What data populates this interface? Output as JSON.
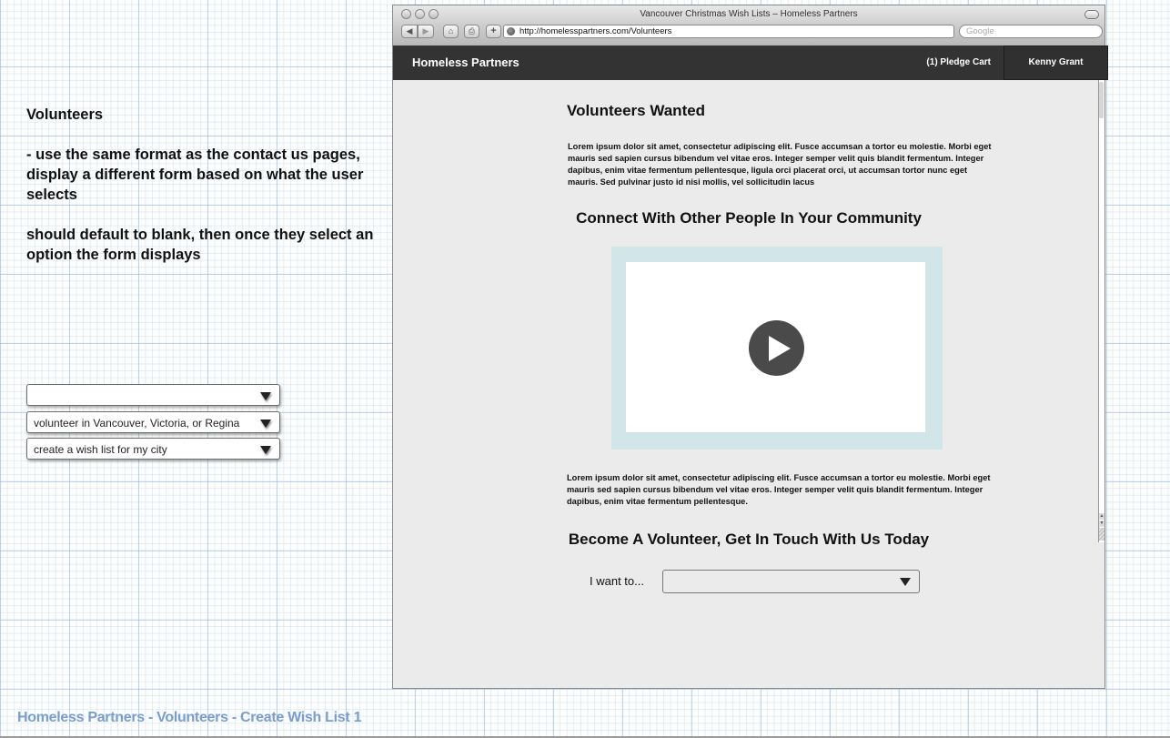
{
  "notes": {
    "title": "Volunteers",
    "paragraphs": [
      "- use the same format as the contact us pages, display a different form based on what the user selects",
      "should default to blank, then once they select an option the form displays"
    ]
  },
  "option_states": [
    {
      "value": ""
    },
    {
      "value": "volunteer in Vancouver, Victoria, or Regina"
    },
    {
      "value": "create a wish list for my city"
    }
  ],
  "footer": {
    "title": "Homeless Partners - Volunteers - Create Wish List 1"
  },
  "browser": {
    "window_title": "Vancouver Christmas Wish Lists – Homeless Partners",
    "url": "http://homelesspartners.com/Volunteers",
    "search_placeholder": "Google",
    "back_icon": "◀",
    "forward_icon": "▶",
    "home_icon": "⌂",
    "print_icon": "⎙",
    "add_icon": "+"
  },
  "site": {
    "brand": "Homeless Partners",
    "pledge_cart": "(1) Pledge Cart",
    "user_name": "Kenny Grant"
  },
  "content": {
    "heading": "Volunteers Wanted",
    "intro": "Lorem ipsum dolor sit amet, consectetur adipiscing elit. Fusce accumsan a tortor eu molestie. Morbi eget mauris sed sapien cursus bibendum vel vitae eros. Integer semper velit quis blandit fermentum. Integer dapibus, enim vitae fermentum pellentesque, ligula orci placerat orci, ut accumsan tortor nunc eget mauris. Sed pulvinar justo id nisi mollis, vel sollicitudin lacus",
    "community_heading": "Connect With Other People In Your Community",
    "video_body": "Lorem ipsum dolor sit amet, consectetur adipiscing elit. Fusce accumsan a tortor eu molestie. Morbi eget mauris sed sapien cursus bibendum vel vitae eros. Integer semper velit quis blandit fermentum. Integer dapibus, enim vitae fermentum pellentesque.",
    "volunteer_heading": "Become A Volunteer, Get In Touch With Us Today",
    "want_label": "I want to...",
    "want_value": ""
  }
}
